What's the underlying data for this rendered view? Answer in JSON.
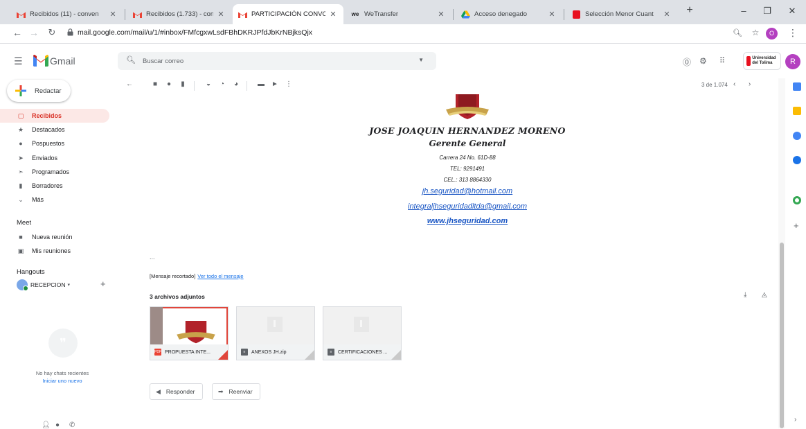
{
  "browser": {
    "tabs": [
      {
        "title": "Recibidos (11) - conven",
        "icon": "gmail-icon"
      },
      {
        "title": "Recibidos (1.733) - con",
        "icon": "gmail-icon"
      },
      {
        "title": "PARTICIPACIÓN CONVO",
        "icon": "gmail-icon",
        "active": true
      },
      {
        "title": "WeTransfer",
        "icon": "wetransfer-icon"
      },
      {
        "title": "Acceso denegado",
        "icon": "google-drive-icon"
      },
      {
        "title": "Selección Menor Cuant",
        "icon": "university-icon"
      }
    ],
    "url": "mail.google.com/mail/u/1/#inbox/FMfcgxwLsdFBhDKRJPfdJbKrNBjksQjx",
    "profile_initial": "O"
  },
  "gmail": {
    "app_name": "Gmail",
    "search_placeholder": "Buscar correo",
    "org_badge": "Universidad del Tolima",
    "account_initial": "R",
    "compose_label": "Redactar",
    "nav": [
      {
        "label": "Recibidos",
        "icon": "inbox-icon",
        "active": true
      },
      {
        "label": "Destacados",
        "icon": "star-icon"
      },
      {
        "label": "Pospuestos",
        "icon": "clock-icon"
      },
      {
        "label": "Enviados",
        "icon": "send-icon"
      },
      {
        "label": "Programados",
        "icon": "scheduled-icon"
      },
      {
        "label": "Borradores",
        "icon": "draft-icon"
      },
      {
        "label": "Más",
        "icon": "chevron-down-icon"
      }
    ],
    "meet": {
      "heading": "Meet",
      "new_meeting": "Nueva reunión",
      "my_meetings": "Mis reuniones"
    },
    "hangouts": {
      "heading": "Hangouts",
      "user": "RECEPCION",
      "no_chats": "No hay chats recientes",
      "start_new": "Iniciar uno nuevo"
    },
    "pager": "3 de 1.074"
  },
  "message": {
    "signature": {
      "name": "JOSE JOAQUIN HERNANDEZ MORENO",
      "role": "Gerente General",
      "address": "Carrera 24 No. 61D-88",
      "tel": "TEL:  9291491",
      "cel": "CEL.: 313 8864330",
      "email1": "jh.seguridad@hotmail.com",
      "email2": "integraljhseguridadltda@gmail.com",
      "website": "www.jhseguridad.com"
    },
    "ellipsis": "...",
    "clipped_text": "[Mensaje recortado]",
    "view_full": "Ver todo el mensaje",
    "attachments_heading": "3 archivos adjuntos",
    "attachments": [
      {
        "name": "PROPUESTA INTE...",
        "type": "pdf",
        "type_color": "#ea4335"
      },
      {
        "name": "ANEXOS JH.zip",
        "type": "archive",
        "type_color": "#5f6368"
      },
      {
        "name": "CERTIFICACIONES ...",
        "type": "archive",
        "type_color": "#5f6368"
      }
    ],
    "reply_label": "Responder",
    "forward_label": "Reenviar"
  }
}
